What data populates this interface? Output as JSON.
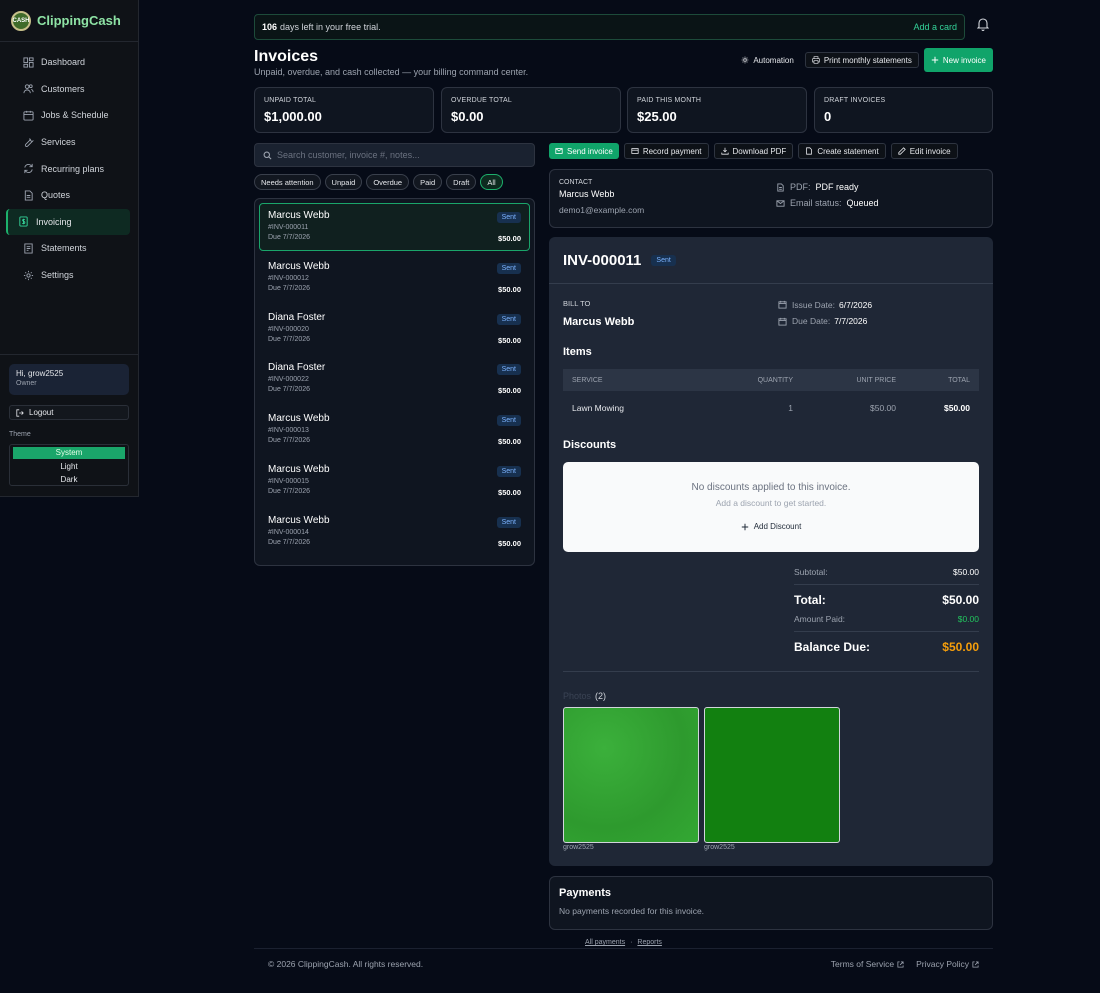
{
  "brand": {
    "name": "ClippingCash",
    "logo_text": "CASH"
  },
  "sidebar": {
    "items": [
      {
        "label": "Dashboard",
        "icon": "dashboard-icon"
      },
      {
        "label": "Customers",
        "icon": "customers-icon"
      },
      {
        "label": "Jobs & Schedule",
        "icon": "calendar-icon"
      },
      {
        "label": "Services",
        "icon": "wrench-icon"
      },
      {
        "label": "Recurring plans",
        "icon": "recurring-icon"
      },
      {
        "label": "Quotes",
        "icon": "quote-icon"
      },
      {
        "label": "Invoicing",
        "icon": "invoice-icon",
        "active": true
      },
      {
        "label": "Statements",
        "icon": "statement-icon"
      },
      {
        "label": "Settings",
        "icon": "gear-icon"
      }
    ],
    "user": {
      "greeting": "Hi, grow2525",
      "role": "Owner"
    },
    "logout_label": "Logout",
    "theme_label": "Theme",
    "theme_options": [
      "System",
      "Light",
      "Dark"
    ],
    "theme_selected": "System"
  },
  "trial": {
    "days": "106",
    "text": "days left in your free trial.",
    "cta": "Add a card"
  },
  "header": {
    "title": "Invoices",
    "subtitle": "Unpaid, overdue, and cash collected — your billing command center.",
    "automation": "Automation",
    "print": "Print monthly statements",
    "new_invoice": "New invoice"
  },
  "stats": [
    {
      "label": "UNPAID TOTAL",
      "value": "$1,000.00"
    },
    {
      "label": "OVERDUE TOTAL",
      "value": "$0.00"
    },
    {
      "label": "PAID THIS MONTH",
      "value": "$25.00"
    },
    {
      "label": "DRAFT INVOICES",
      "value": "0"
    }
  ],
  "search": {
    "placeholder": "Search customer, invoice #, notes..."
  },
  "filters": [
    "Needs attention",
    "Unpaid",
    "Overdue",
    "Paid",
    "Draft",
    "All"
  ],
  "filter_selected": "All",
  "invoices": [
    {
      "name": "Marcus Webb",
      "number": "#INV-000011",
      "due": "Due 7/7/2026",
      "status": "Sent",
      "amount": "$50.00",
      "selected": true
    },
    {
      "name": "Marcus Webb",
      "number": "#INV-000012",
      "due": "Due 7/7/2026",
      "status": "Sent",
      "amount": "$50.00"
    },
    {
      "name": "Diana Foster",
      "number": "#INV-000020",
      "due": "Due 7/7/2026",
      "status": "Sent",
      "amount": "$50.00"
    },
    {
      "name": "Diana Foster",
      "number": "#INV-000022",
      "due": "Due 7/7/2026",
      "status": "Sent",
      "amount": "$50.00"
    },
    {
      "name": "Marcus Webb",
      "number": "#INV-000013",
      "due": "Due 7/7/2026",
      "status": "Sent",
      "amount": "$50.00"
    },
    {
      "name": "Marcus Webb",
      "number": "#INV-000015",
      "due": "Due 7/7/2026",
      "status": "Sent",
      "amount": "$50.00"
    },
    {
      "name": "Marcus Webb",
      "number": "#INV-000014",
      "due": "Due 7/7/2026",
      "status": "Sent",
      "amount": "$50.00"
    }
  ],
  "actions": {
    "send": "Send invoice",
    "record": "Record payment",
    "download": "Download PDF",
    "statement": "Create statement",
    "edit": "Edit invoice"
  },
  "contact": {
    "label": "CONTACT",
    "name": "Marcus Webb",
    "email": "demo1@example.com",
    "pdf_label": "PDF:",
    "pdf_value": "PDF ready",
    "email_status_label": "Email status:",
    "email_status_value": "Queued"
  },
  "invoice": {
    "id": "INV-000011",
    "status": "Sent",
    "bill_to_label": "BILL TO",
    "bill_to_name": "Marcus Webb",
    "issue_label": "Issue Date:",
    "issue_date": "6/7/2026",
    "due_label": "Due Date:",
    "due_date": "7/7/2026",
    "items_title": "Items",
    "columns": [
      "SERVICE",
      "QUANTITY",
      "UNIT PRICE",
      "TOTAL"
    ],
    "items": [
      {
        "service": "Lawn Mowing",
        "quantity": "1",
        "unit_price": "$50.00",
        "total": "$50.00"
      }
    ],
    "discounts_title": "Discounts",
    "no_discounts": "No discounts applied to this invoice.",
    "no_discounts_hint": "Add a discount to get started.",
    "add_discount": "Add Discount",
    "subtotal_label": "Subtotal:",
    "subtotal": "$50.00",
    "total_label": "Total:",
    "total": "$50.00",
    "paid_label": "Amount Paid:",
    "paid": "$0.00",
    "balance_label": "Balance Due:",
    "balance": "$50.00",
    "photos_label": "Photos",
    "photos_count": "(2)",
    "photos": [
      {
        "caption": "grow2525",
        "color": "#32a032"
      },
      {
        "caption": "grow2525",
        "color": "#128010"
      }
    ]
  },
  "payments": {
    "title": "Payments",
    "empty": "No payments recorded for this invoice."
  },
  "footer": {
    "all_payments": "All payments",
    "dot": "·",
    "reports": "Reports",
    "copyright": "© 2026 ClippingCash. All rights reserved.",
    "terms": "Terms of Service",
    "privacy": "Privacy Policy"
  },
  "colors": {
    "accent": "#10a46a",
    "balance": "#f59e0b",
    "paid": "#22c55e",
    "badge": "#7cb3ff"
  }
}
